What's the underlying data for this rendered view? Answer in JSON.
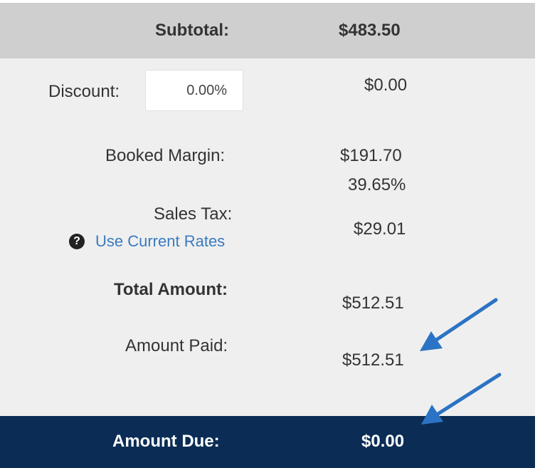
{
  "summary": {
    "subtotal_label": "Subtotal:",
    "subtotal_value": "$483.50",
    "discount_label": "Discount:",
    "discount_input_value": "0.00%",
    "discount_value": "$0.00",
    "booked_margin_label": "Booked Margin:",
    "booked_margin_amount": "$191.70",
    "booked_margin_percent": "39.65%",
    "sales_tax_label": "Sales Tax:",
    "use_current_rates_link": "Use Current Rates",
    "sales_tax_value": "$29.01",
    "total_amount_label": "Total Amount:",
    "total_amount_value": "$512.51",
    "amount_paid_label": "Amount Paid:",
    "amount_paid_value": "$512.51",
    "amount_due_label": "Amount Due:",
    "amount_due_value": "$0.00"
  },
  "icons": {
    "help": "question-circle-icon",
    "help_glyph": "?",
    "annotation_arrow": "arrow-icon"
  },
  "colors": {
    "subtotal_bar": "#cfcfcf",
    "body_background": "#efefef",
    "amount_due_bar": "#0b2d55",
    "link": "#3a7bbf",
    "annotation_arrow": "#2b73c4"
  }
}
